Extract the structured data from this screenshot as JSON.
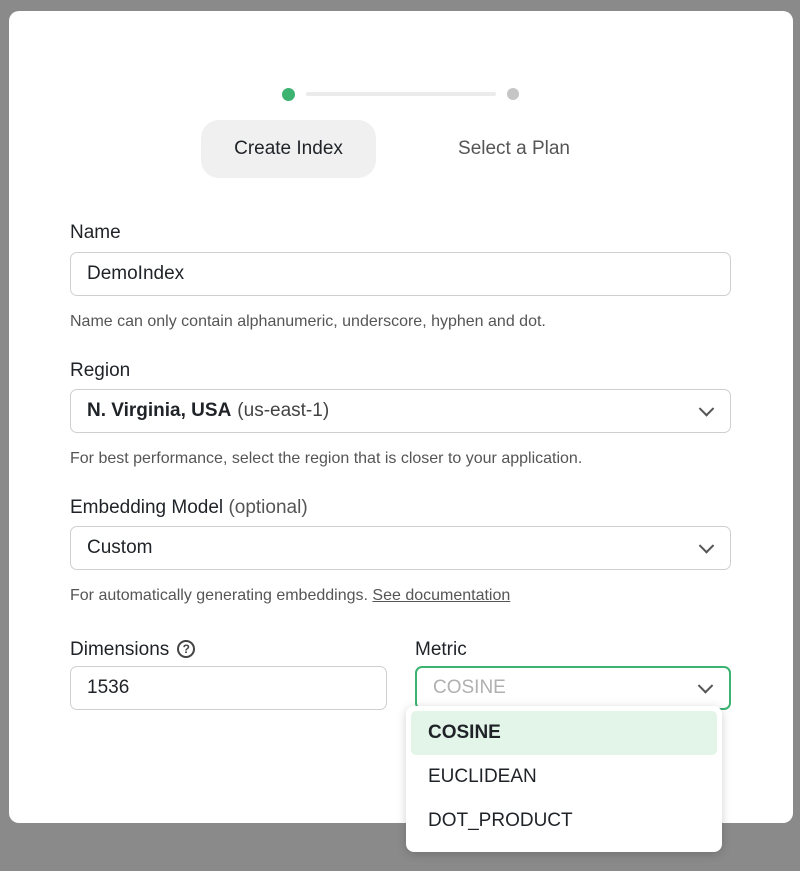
{
  "stepper": {
    "steps": [
      {
        "label": "Create Index",
        "active": true
      },
      {
        "label": "Select a Plan",
        "active": false
      }
    ],
    "active_color": "#3cb371"
  },
  "form": {
    "name": {
      "label": "Name",
      "value": "DemoIndex",
      "help": "Name can only contain alphanumeric, underscore, hyphen and dot."
    },
    "region": {
      "label": "Region",
      "value_main": "N. Virginia, USA",
      "value_sub": "(us-east-1)",
      "help": "For best performance, select the region that is closer to your application."
    },
    "embedding_model": {
      "label": "Embedding Model",
      "label_suffix": "(optional)",
      "value": "Custom",
      "help": "For automatically generating embeddings.",
      "help_link": "See documentation"
    },
    "dimensions": {
      "label": "Dimensions",
      "help_icon": "question-circle-icon",
      "value": "1536"
    },
    "metric": {
      "label": "Metric",
      "placeholder": "COSINE",
      "options": [
        "COSINE",
        "EUCLIDEAN",
        "DOT_PRODUCT"
      ],
      "highlighted": "COSINE"
    }
  }
}
